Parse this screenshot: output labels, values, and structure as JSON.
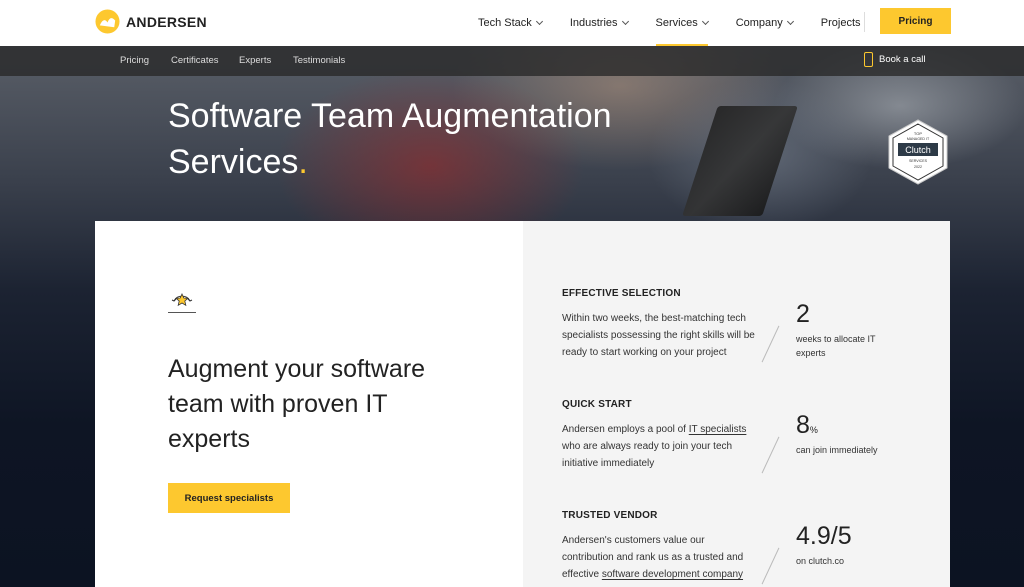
{
  "brand": {
    "name": "ANDERSEN",
    "accent": "#fdc82f"
  },
  "nav": {
    "items": [
      {
        "label": "Tech Stack",
        "dropdown": true
      },
      {
        "label": "Industries",
        "dropdown": true
      },
      {
        "label": "Services",
        "dropdown": true,
        "active": true
      },
      {
        "label": "Company",
        "dropdown": true
      },
      {
        "label": "Projects",
        "dropdown": false
      }
    ],
    "pricing_label": "Pricing"
  },
  "subnav": {
    "items": [
      "Pricing",
      "Certificates",
      "Experts",
      "Testimonials"
    ],
    "book_call_label": "Book a call"
  },
  "hero": {
    "title_line1": "Software Team Augmentation",
    "title_line2": "Services",
    "title_dot": "."
  },
  "badge": {
    "top": "TOP",
    "line2": "MANAGED IT",
    "brand": "Clutch",
    "line4": "SERVICES",
    "year": "2022"
  },
  "intro": {
    "title": "Augment your software team with proven IT experts",
    "cta_label": "Request specialists"
  },
  "features": [
    {
      "heading": "EFFECTIVE SELECTION",
      "text": "Within two weeks, the best-matching tech specialists possessing the right skills will be ready to start working on your project",
      "value": "2",
      "unit": "",
      "caption": "weeks to allocate IT experts"
    },
    {
      "heading": "QUICK START",
      "text_before": "Andersen employs a pool of ",
      "link": "IT specialists",
      "text_after": " who are always ready to join your tech initiative immediately",
      "value": "8",
      "unit": "%",
      "caption": "can join immediately"
    },
    {
      "heading": "TRUSTED VENDOR",
      "text_before": "Andersen's customers value our contribution and rank us as a trusted and effective ",
      "link": "software development company",
      "text_after": "",
      "value": "4.9/5",
      "unit": "",
      "caption": "on clutch.co"
    }
  ]
}
